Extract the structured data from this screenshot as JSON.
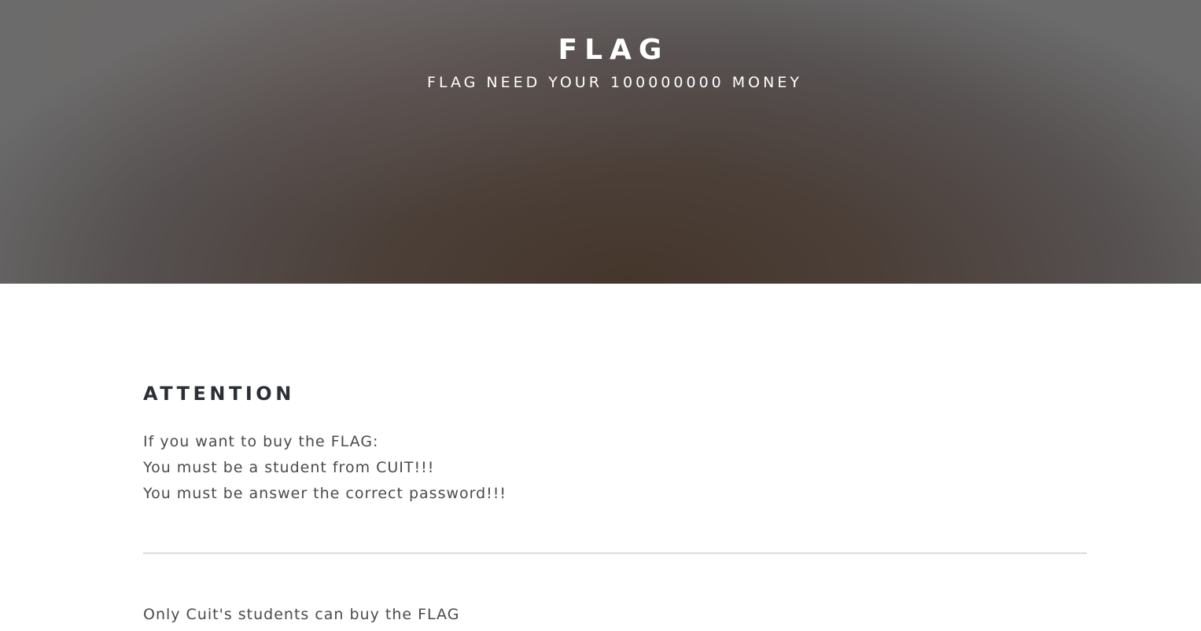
{
  "header": {
    "title": "FLAG",
    "subtitle": "FLAG NEED YOUR 100000000 MONEY"
  },
  "main": {
    "heading": "ATTENTION",
    "lines": [
      "If you want to buy the FLAG:",
      "You must be a student from CUIT!!!",
      "You must be answer the correct password!!!"
    ],
    "footer_note": "Only Cuit's students can buy the FLAG"
  },
  "colors": {
    "hero_center": "#45362b",
    "hero_edge": "#6b6b6b",
    "heading_text": "#2b3036",
    "body_text": "#4a4a4f",
    "divider": "#dcdcdc"
  }
}
